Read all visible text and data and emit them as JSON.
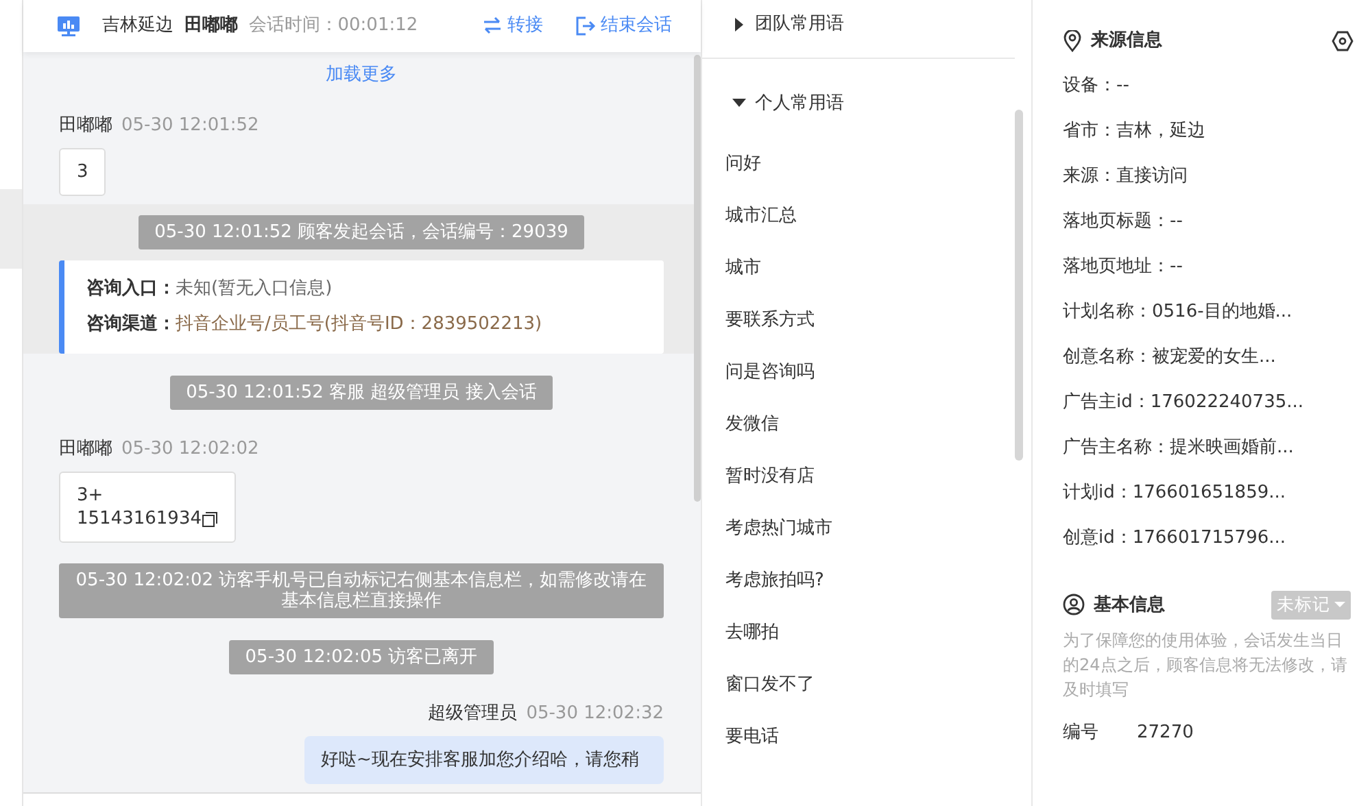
{
  "header": {
    "location": "吉林延边",
    "visitor": "田嘟嘟",
    "duration": "会话时间：00:01:12",
    "actions": [
      {
        "kind": "transfer",
        "label": "转接"
      },
      {
        "kind": "end",
        "label": "结束会话"
      }
    ]
  },
  "chat": {
    "load_more": "加载更多",
    "messages": [
      {
        "kind": "customer",
        "sender": "田嘟嘟",
        "time": "05-30 12:01:52",
        "lines": [
          "3"
        ],
        "highlighted": false
      },
      {
        "kind": "system",
        "text": "05-30 12:01:52 顾客发起会话，会话编号：29039",
        "highlighted": true
      },
      {
        "kind": "info",
        "rows": [
          {
            "label": "咨询入口：",
            "value": "未知(暂无入口信息)",
            "accent": false
          },
          {
            "label": "咨询渠道：",
            "value": "抖音企业号/员工号(抖音号ID：2839502213)",
            "accent": true
          }
        ],
        "highlighted": true
      },
      {
        "kind": "system",
        "text": "05-30 12:01:52 客服 超级管理员 接入会话",
        "highlighted": false
      },
      {
        "kind": "customer",
        "sender": "田嘟嘟",
        "time": "05-30 12:02:02",
        "lines": [
          "3+",
          "15143161934"
        ],
        "copyable": true,
        "highlighted": false
      },
      {
        "kind": "system",
        "text": "05-30 12:02:02 访客手机号已自动标记右侧基本信息栏，如需修改请在基本信息栏直接操作",
        "highlighted": false
      },
      {
        "kind": "system",
        "text": "05-30 12:02:05 访客已离开",
        "highlighted": false
      },
      {
        "kind": "agent",
        "sender": "超级管理员",
        "time": "05-30 12:02:32",
        "lines": [
          "好哒~现在安排客服加您介绍哈，请您稍"
        ],
        "highlighted": false
      }
    ]
  },
  "phrases": {
    "groups": [
      {
        "title": "团队常用语",
        "expanded": false
      },
      {
        "title": "个人常用语",
        "expanded": true,
        "items": [
          "问好",
          "城市汇总",
          "城市",
          "要联系方式",
          "问是咨询吗",
          "发微信",
          "暂时没有店",
          "考虑热门城市",
          "考虑旅拍吗?",
          "去哪拍",
          "窗口发不了",
          "要电话"
        ]
      }
    ]
  },
  "source_info": {
    "title": "来源信息",
    "rows": [
      "设备：--",
      "省市：吉林，延边",
      "来源：直接访问",
      "落地页标题：--",
      "落地页地址：--",
      "计划名称：0516-目的地婚...",
      "创意名称：被宠爱的女生...",
      "广告主id：176022240735...",
      "广告主名称：提米映画婚前...",
      "计划id：176601651859...",
      "创意id：176601715796..."
    ]
  },
  "basic_info": {
    "title": "基本信息",
    "tag": "未标记",
    "notice": "为了保障您的使用体验，会话发生当日的24点之后，顾客信息将无法修改，请及时填写",
    "fields": [
      {
        "label": "编号",
        "value": "27270"
      }
    ]
  }
}
